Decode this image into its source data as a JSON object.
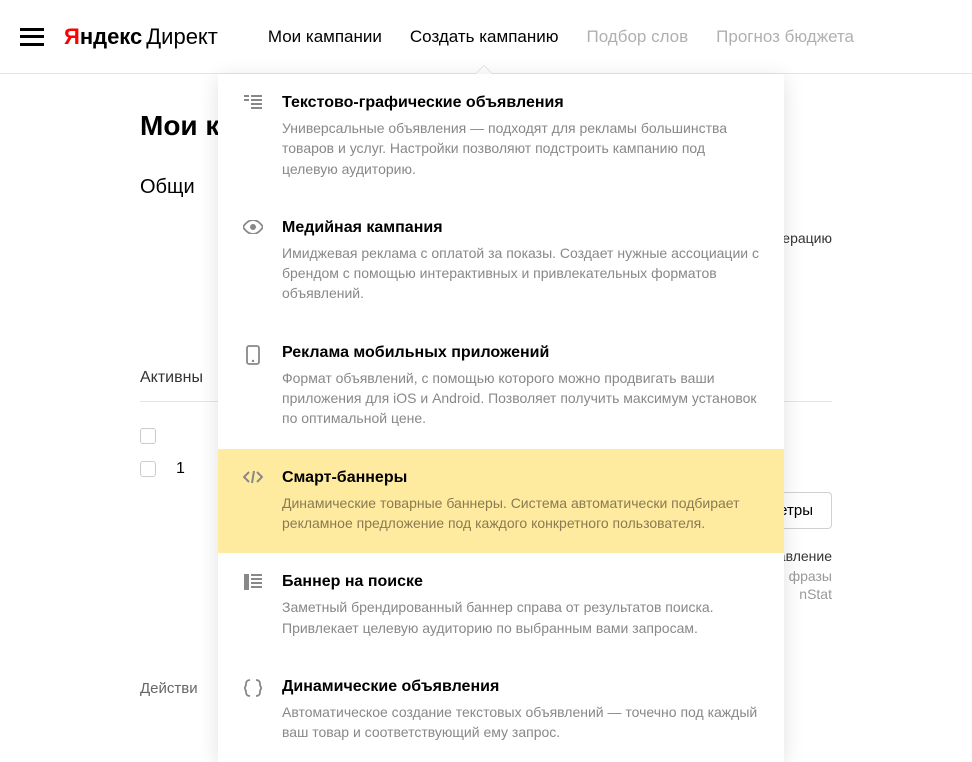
{
  "logo": {
    "brand_y": "Я",
    "brand_rest": "ндекс",
    "product": "Директ"
  },
  "nav": {
    "my_campaigns": "Мои кампании",
    "create_campaign": "Создать кампанию",
    "word_selection": "Подбор слов",
    "budget_forecast": "Прогноз бюджета"
  },
  "page": {
    "title_partial": "Мои к",
    "stats_partial": "Общи",
    "active_partial": "Активны",
    "row_num": "1",
    "actions_partial": "Действи",
    "moderation_partial": "кампания пройдёт модерацию",
    "params_button_partial": "араметры",
    "manage_partial": "ое управление",
    "phrases_partial": "фразы",
    "stat_partial": "nStat"
  },
  "dropdown": [
    {
      "title": "Текстово-графические объявления",
      "desc": "Универсальные объявления — подходят для рекламы большинства товаров и услуг. Настройки позволяют подстроить кампанию под целевую аудиторию."
    },
    {
      "title": "Медийная кампания",
      "desc": "Имиджевая реклама с оплатой за показы. Создает нужные ассоциации с брендом с помощью интерактивных и привлекательных форматов объявлений."
    },
    {
      "title": "Реклама мобильных приложений",
      "desc": "Формат объявлений, с помощью которого можно продвигать ваши приложения для iOS и Android. Позволяет получить максимум установок по оптимальной цене."
    },
    {
      "title": "Смарт-баннеры",
      "desc": "Динамические товарные баннеры. Система автоматически подбирает рекламное предложение под каждого конкретного пользователя."
    },
    {
      "title": "Баннер на поиске",
      "desc": "Заметный брендированный баннер справа от результатов поиска. Привлекает целевую аудиторию по выбранным вами запросам."
    },
    {
      "title": "Динамические объявления",
      "desc": "Автоматическое создание текстовых объявлений — точечно под каждый ваш товар и соответствующий ему запрос."
    }
  ]
}
